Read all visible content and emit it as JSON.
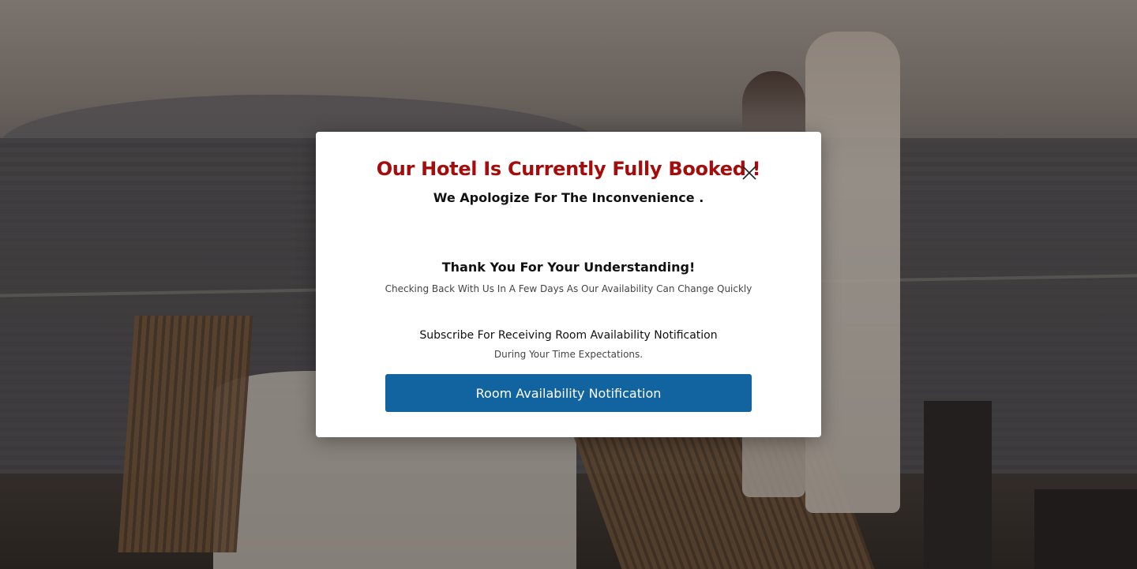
{
  "modal": {
    "title": "Our Hotel Is Currently Fully Booked !",
    "subtitle": "We Apologize For The Inconvenience .",
    "thanks": "Thank You For Your Understanding!",
    "checking": "Checking Back With Us In A Few Days As Our Availability Can Change Quickly",
    "subscribe": "Subscribe For Receiving Room Availability Notification",
    "during": "During Your Time Expectations.",
    "cta_label": "Room Availability Notification",
    "close_icon": "close-icon"
  },
  "colors": {
    "title": "#a50c0c",
    "cta_background": "#1264a0",
    "modal_background": "#ffffff"
  }
}
